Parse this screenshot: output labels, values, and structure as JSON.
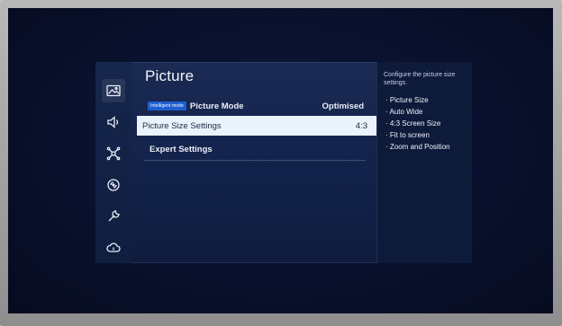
{
  "menu": {
    "title": "Picture",
    "rows": [
      {
        "badge": "Intelligent mode",
        "label": "Picture Mode",
        "value": "Optimised"
      },
      {
        "label": "Picture Size Settings",
        "value": "4:3"
      },
      {
        "label": "Expert Settings"
      }
    ]
  },
  "sidebar": {
    "icons": [
      "picture-icon",
      "sound-icon",
      "connection-icon",
      "broadcast-icon",
      "support-wrench-icon",
      "cloud-icon"
    ]
  },
  "help": {
    "description": "Configure the picture size settings.",
    "items": [
      "Picture Size",
      "Auto Wide",
      "4:3 Screen Size",
      "Fit to screen",
      "Zoom and Position"
    ]
  },
  "colors": {
    "highlight": "#eaf2fb",
    "badge": "#1d5fd0",
    "menu_bg": "#12224a"
  }
}
